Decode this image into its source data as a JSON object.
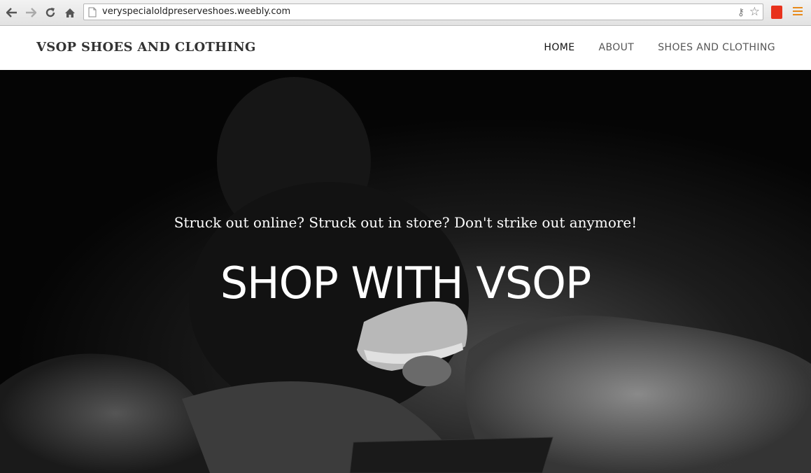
{
  "browser": {
    "url": "veryspecialoldpreserveshoes.weebly.com",
    "icons": [
      "back-icon",
      "forward-icon",
      "reload-icon",
      "home-icon",
      "page-icon",
      "key-icon",
      "star-icon",
      "pdf-extension-icon",
      "menu-icon"
    ]
  },
  "site": {
    "logo": "VSOP SHOES AND CLOTHING",
    "nav": [
      {
        "label": "HOME",
        "active": true
      },
      {
        "label": "ABOUT",
        "active": false
      },
      {
        "label": "SHOES AND CLOTHING",
        "active": false
      }
    ]
  },
  "hero": {
    "tagline": "Struck out online? Struck out in store? Don't strike out anymore!",
    "headline": "SHOP WITH VSOP"
  },
  "colors": {
    "menu_accent": "#e88a1a",
    "extension_red": "#e8321d",
    "header_bg": "#ffffff",
    "hero_bg": "#060606"
  }
}
